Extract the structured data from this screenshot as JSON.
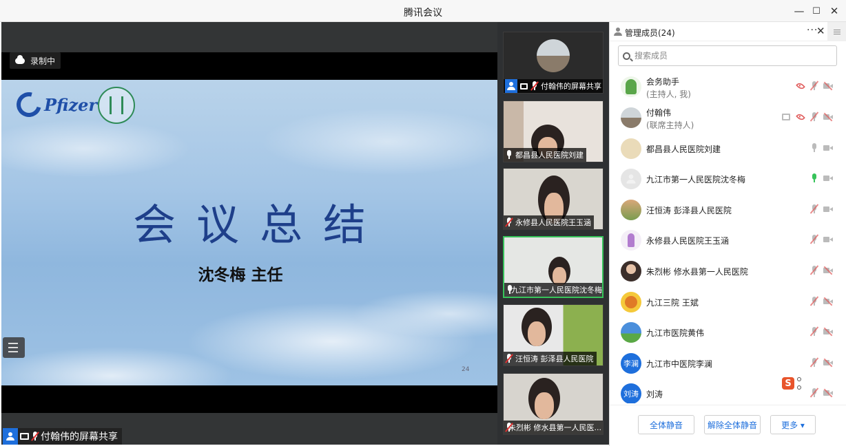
{
  "window": {
    "title": "腾讯会议",
    "minimize": "—",
    "maximize": "☐",
    "close": "✕"
  },
  "share": {
    "recording_label": "录制中",
    "sharer_label": "付翰伟的屏幕共享",
    "slide": {
      "logo_text": "Pfizer",
      "title": "会议总结",
      "subtitle": "沈冬梅 主任",
      "page_number": "24"
    }
  },
  "video_tiles": [
    {
      "name": "付翰伟的屏幕共享",
      "active": false
    },
    {
      "name": "都昌县人民医院刘建",
      "active": false
    },
    {
      "name": "永修县人民医院王玉涵",
      "active": false
    },
    {
      "name": "九江市第一人民医院沈冬梅",
      "active": true
    },
    {
      "name": "汪恒涛 彭泽县人民医院",
      "active": false
    },
    {
      "name": "朱烈彬 修水县第一人民医...",
      "active": false
    }
  ],
  "panel": {
    "title": "管理成员(24)",
    "more": "···",
    "close": "✕",
    "search_placeholder": "搜索成员",
    "members": [
      {
        "name": "会务助手",
        "role": "(主持人, 我)",
        "avatar_color": "#e9f3e3"
      },
      {
        "name": "付翰伟",
        "role": "(联席主持人)",
        "avatar_color": "#9aa4a8"
      },
      {
        "name": "都昌县人民医院刘建",
        "role": "",
        "avatar_color": "#e6d8b8"
      },
      {
        "name": "九江市第一人民医院沈冬梅",
        "role": "",
        "avatar_color": "#dedede"
      },
      {
        "name": "汪恒涛 彭泽县人民医院",
        "role": "",
        "avatar_color": "#c98c5a"
      },
      {
        "name": "永修县人民医院王玉涵",
        "role": "",
        "avatar_color": "#efe3f3"
      },
      {
        "name": "朱烈彬 修水县第一人民医院",
        "role": "",
        "avatar_color": "#4a3b36"
      },
      {
        "name": "九江三院 王斌",
        "role": "",
        "avatar_color": "#f2b12b"
      },
      {
        "name": "九江市医院黄伟",
        "role": "",
        "avatar_color": "#4c8fd6"
      },
      {
        "name": "九江市中医院李澜",
        "role": "",
        "avatar_text": "李澜",
        "avatar_color": "#1e6fdc"
      },
      {
        "name": "刘涛",
        "role": "",
        "avatar_text": "刘涛",
        "avatar_color": "#1e6fdc"
      }
    ],
    "footer": {
      "mute_all": "全体静音",
      "unmute_all": "解除全体静音",
      "more": "更多 ▾"
    }
  },
  "ime": {
    "logo_letter": "S"
  }
}
